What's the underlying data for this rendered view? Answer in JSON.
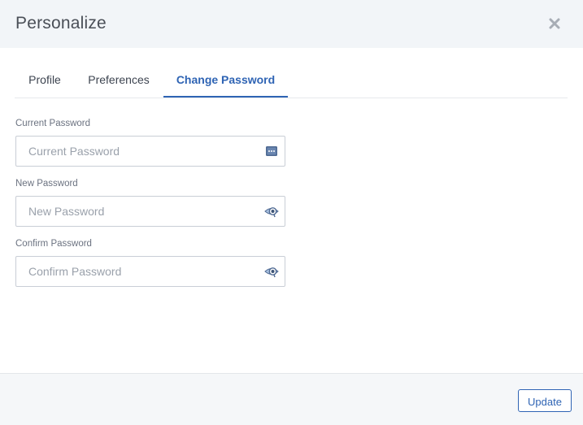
{
  "modal": {
    "title": "Personalize"
  },
  "tabs": [
    {
      "label": "Profile",
      "active": false
    },
    {
      "label": "Preferences",
      "active": false
    },
    {
      "label": "Change Password",
      "active": true
    }
  ],
  "form": {
    "current_password": {
      "label": "Current Password",
      "placeholder": "Current Password",
      "value": "",
      "icon": "password-manager-icon"
    },
    "new_password": {
      "label": "New Password",
      "placeholder": "New Password",
      "value": "",
      "icon": "show-password-icon"
    },
    "confirm_password": {
      "label": "Confirm Password",
      "placeholder": "Confirm Password",
      "value": "",
      "icon": "show-password-icon"
    }
  },
  "footer": {
    "update_label": "Update"
  },
  "colors": {
    "accent": "#2f64b4",
    "header_bg": "#f2f5f8",
    "footer_bg": "#f5f7f9",
    "border": "#c9ced6"
  }
}
